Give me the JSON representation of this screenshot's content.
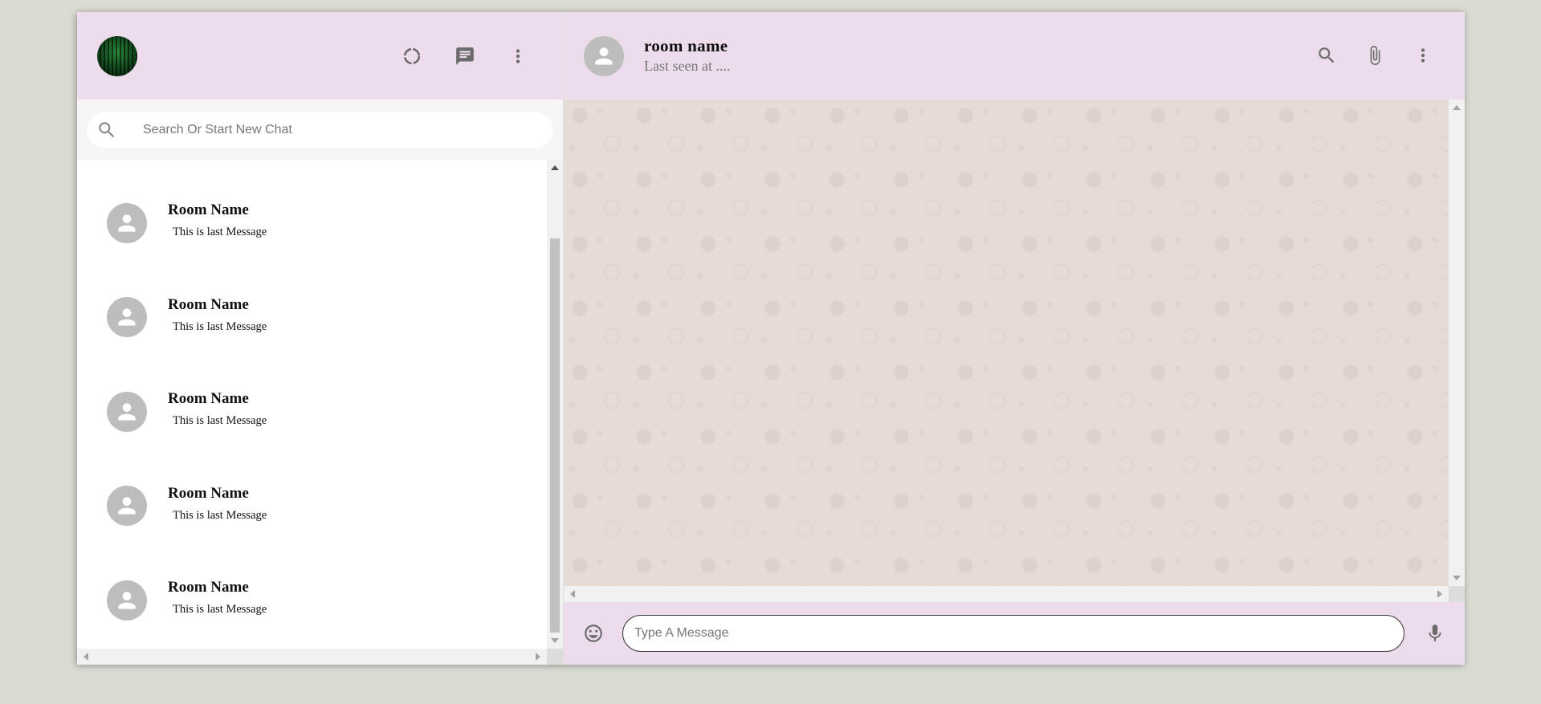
{
  "sidebar": {
    "header": {
      "icons": [
        "status-icon",
        "chat-icon",
        "more-vert-icon"
      ]
    },
    "search": {
      "placeholder": "Search Or Start New Chat"
    },
    "chats": [
      {
        "name": "Room Name",
        "last_message": "This is last Message"
      },
      {
        "name": "Room Name",
        "last_message": "This is last Message"
      },
      {
        "name": "Room Name",
        "last_message": "This is last Message"
      },
      {
        "name": "Room Name",
        "last_message": "This is last Message"
      },
      {
        "name": "Room Name",
        "last_message": "This is last Message"
      }
    ]
  },
  "chat": {
    "header": {
      "room_name": "room name",
      "last_seen": "Last seen at ....",
      "icons": [
        "search-icon",
        "attach-file-icon",
        "more-vert-icon"
      ]
    },
    "footer": {
      "message_placeholder": "Type A Message",
      "icons": [
        "emoji-icon",
        "mic-icon"
      ]
    }
  },
  "colors": {
    "header_bg": "#eddcec",
    "chat_bg": "#e5ddd5",
    "page_bg": "#dadbd3",
    "avatar_bg": "#bdbdbd"
  }
}
